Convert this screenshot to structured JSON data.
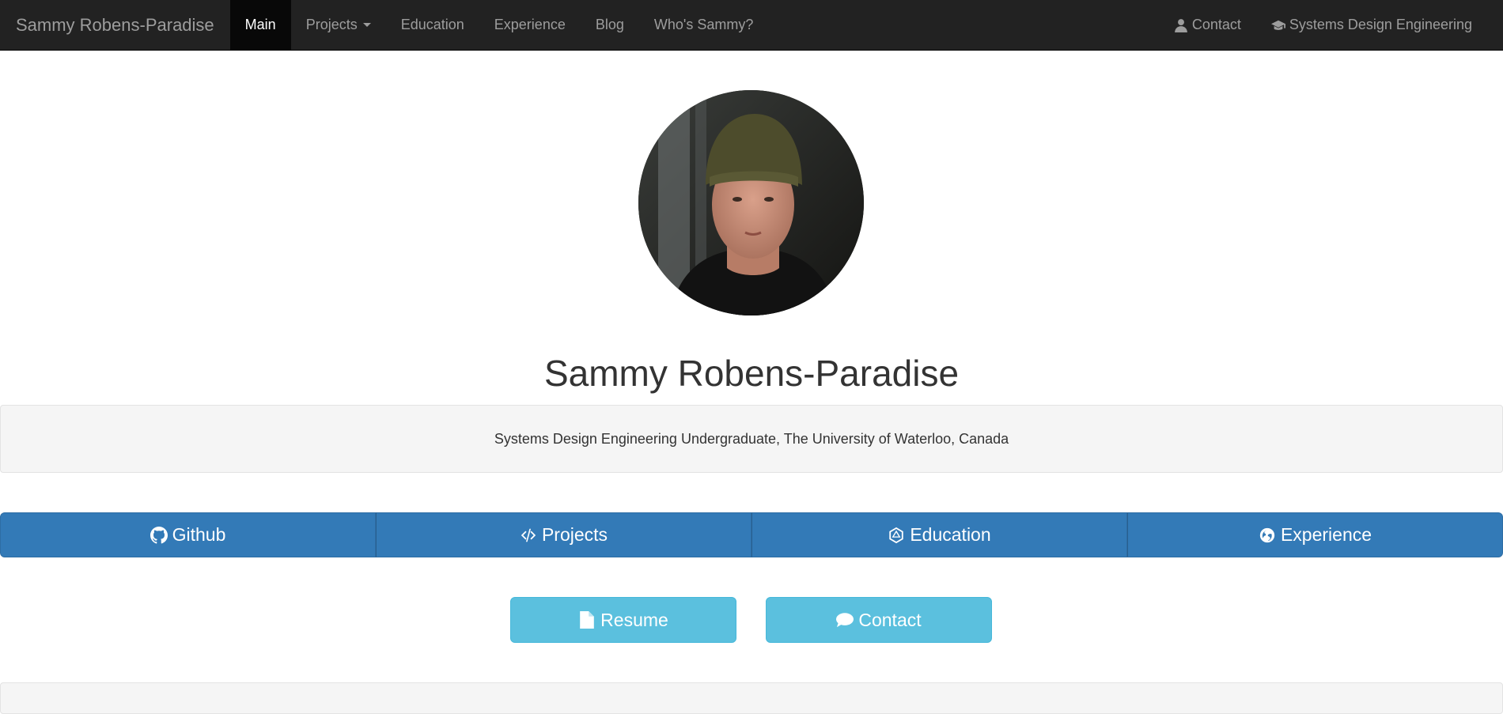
{
  "navbar": {
    "brand": "Sammy Robens-Paradise",
    "items": [
      {
        "label": "Main",
        "active": true
      },
      {
        "label": "Projects",
        "dropdown": true
      },
      {
        "label": "Education"
      },
      {
        "label": "Experience"
      },
      {
        "label": "Blog"
      },
      {
        "label": "Who's Sammy?"
      }
    ],
    "right_items": [
      {
        "label": "Contact",
        "icon": "user-icon"
      },
      {
        "label": "Systems Design Engineering",
        "icon": "graduation-cap-icon"
      }
    ]
  },
  "hero": {
    "name": "Sammy Robens-Paradise",
    "tagline": "Systems Design Engineering Undergraduate, The University of Waterloo, Canada"
  },
  "buttons": {
    "primary": [
      {
        "label": "Github",
        "icon": "github-icon"
      },
      {
        "label": "Projects",
        "icon": "code-icon"
      },
      {
        "label": "Education",
        "icon": "geometric-icon"
      },
      {
        "label": "Experience",
        "icon": "globe-icon"
      }
    ],
    "resume": {
      "label": "Resume",
      "icon": "file-icon"
    },
    "contact": {
      "label": "Contact",
      "icon": "comment-icon"
    }
  },
  "colors": {
    "navbar_bg": "#222222",
    "nav_active_bg": "#080808",
    "primary": "#337ab7",
    "info": "#5bc0de",
    "well_bg": "#f5f5f5"
  }
}
